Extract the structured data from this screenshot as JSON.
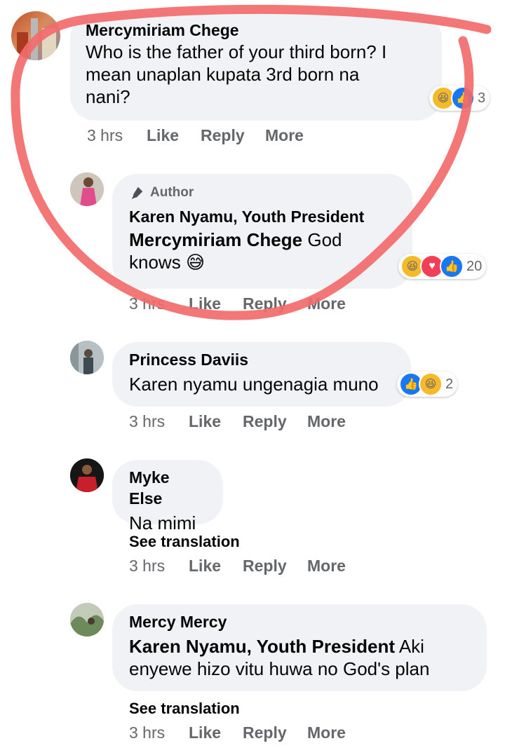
{
  "comments": [
    {
      "author": "Mercymiriam Chege",
      "text_lines": [
        "Who is the father of your third born? I",
        "mean unaplan kupata 3rd born na",
        "nani?"
      ],
      "reaction_count": "3",
      "time": "3 hrs",
      "like": "Like",
      "reply": "Reply",
      "more": "More"
    },
    {
      "badge": "Author",
      "author": "Karen Nyamu, Youth President",
      "mention": "Mercymiriam Chege",
      "text_a": "God",
      "text_b": "knows",
      "emoji": "😅",
      "reaction_count": "20",
      "time": "3 hrs",
      "like": "Like",
      "reply": "Reply",
      "more": "More"
    },
    {
      "author": "Princess Daviis",
      "text": "Karen nyamu ungenagia muno",
      "reaction_count": "2",
      "time": "3 hrs",
      "like": "Like",
      "reply": "Reply",
      "more": "More"
    },
    {
      "author": "Myke Else",
      "text": "Na mimi",
      "see_translation": "See translation",
      "time": "3 hrs",
      "like": "Like",
      "reply": "Reply",
      "more": "More"
    },
    {
      "author": "Mercy Mercy",
      "mention": "Karen Nyamu, Youth President",
      "text_a": "Aki",
      "text_b": "enyewe hizo vitu huwa no God's plan",
      "see_translation": "See translation",
      "time": "3 hrs",
      "like": "Like",
      "reply": "Reply",
      "more": "More"
    }
  ],
  "colors": {
    "annotation": "#f26b6b",
    "bubble": "#f0f2f5",
    "meta": "#65676b"
  }
}
